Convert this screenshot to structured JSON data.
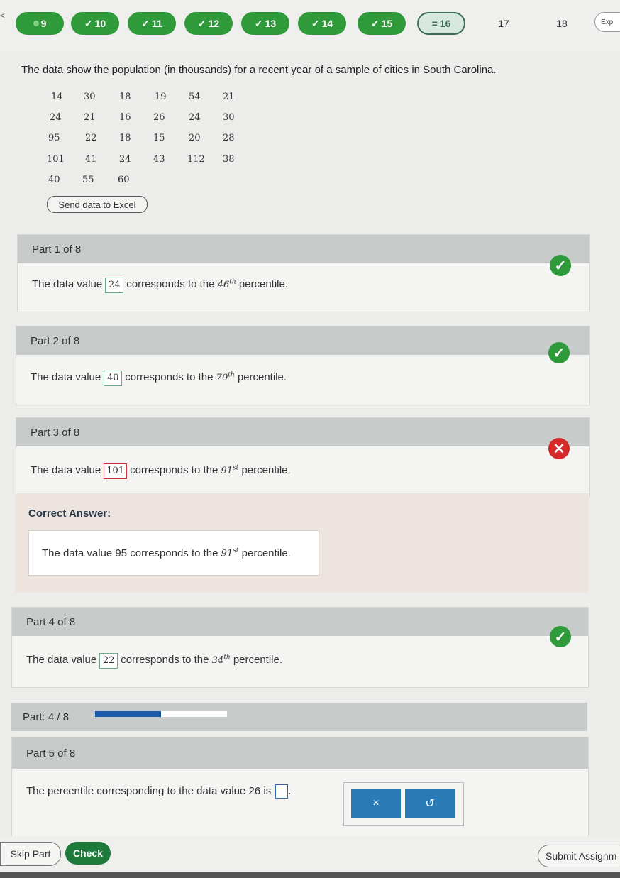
{
  "nav": {
    "edge_mark": "<",
    "items": [
      {
        "label": "9",
        "state": "current"
      },
      {
        "label": "10",
        "state": "done"
      },
      {
        "label": "11",
        "state": "done"
      },
      {
        "label": "12",
        "state": "done"
      },
      {
        "label": "13",
        "state": "done"
      },
      {
        "label": "14",
        "state": "done"
      },
      {
        "label": "15",
        "state": "done"
      },
      {
        "label": "16",
        "state": "partial"
      },
      {
        "label": "17",
        "state": "none"
      },
      {
        "label": "18",
        "state": "none"
      }
    ],
    "help_label": "Exp"
  },
  "question": {
    "text": "The data show the population (in thousands) for a recent year of a sample of cities in South Carolina.",
    "data_rows": [
      [
        "14",
        "30",
        "18",
        "19",
        "54",
        "21"
      ],
      [
        "24",
        "21",
        "16",
        "26",
        "24",
        "30"
      ],
      [
        "95",
        "22",
        "18",
        "15",
        "20",
        "28"
      ],
      [
        "101",
        "41",
        "24",
        "43",
        "112",
        "38"
      ],
      [
        "40",
        "55",
        "60"
      ]
    ],
    "excel_button": "Send data to Excel"
  },
  "parts": [
    {
      "title": "Part 1 of 8",
      "prefix": "The data value",
      "value": "24",
      "mid": "corresponds to the",
      "pct": "46",
      "sup": "th",
      "suffix": "percentile."
    },
    {
      "title": "Part 2 of 8",
      "prefix": "The data value",
      "value": "40",
      "mid": "corresponds to the",
      "pct": "70",
      "sup": "th",
      "suffix": "percentile."
    },
    {
      "title": "Part 3 of 8",
      "prefix": "The data value",
      "value": "101",
      "mid": "corresponds to the",
      "pct": "91",
      "sup": "st",
      "suffix": "percentile."
    },
    {
      "title": "Part 4 of 8",
      "prefix": "The data value",
      "value": "22",
      "mid": "corresponds to the",
      "pct": "34",
      "sup": "th",
      "suffix": "percentile."
    }
  ],
  "correct": {
    "title": "Correct Answer:",
    "text": "The data value 95 corresponds to the",
    "pct": "91",
    "sup": "st",
    "suffix": "percentile."
  },
  "progress": {
    "label": "Part: 4 / 8",
    "fraction": 0.5
  },
  "part5": {
    "title": "Part 5 of 8",
    "text": "The percentile corresponding to the data value 26 is",
    "end": "."
  },
  "toolpad": {
    "clear": "×",
    "undo": "↺"
  },
  "footer": {
    "skip": "Skip Part",
    "check": "Check",
    "submit": "Submit Assignm"
  }
}
